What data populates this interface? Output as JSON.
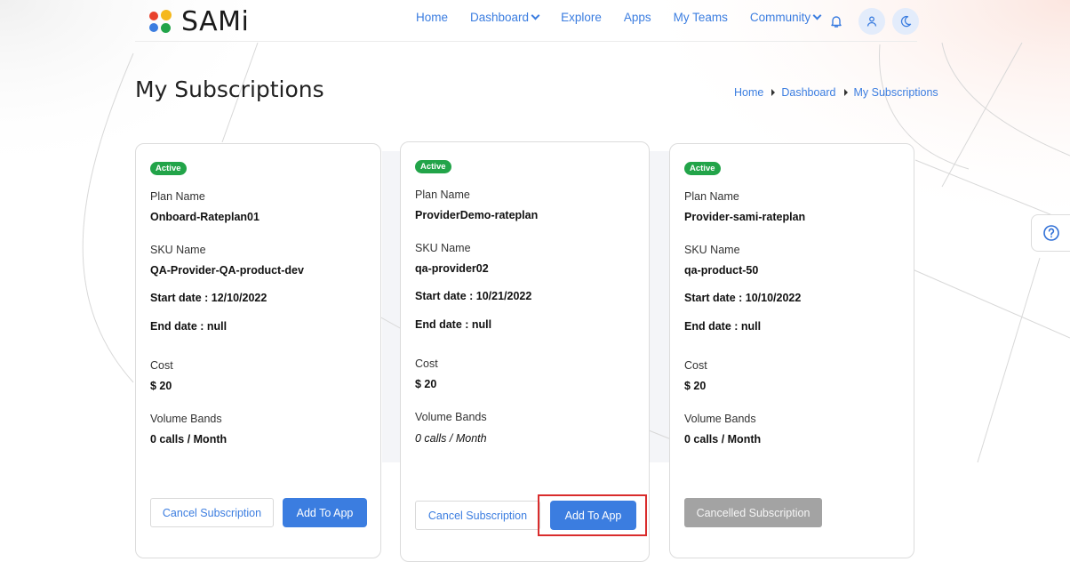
{
  "app": {
    "name": "SAMi"
  },
  "nav": {
    "items": [
      {
        "label": "Home",
        "has_dropdown": false
      },
      {
        "label": "Dashboard",
        "has_dropdown": true
      },
      {
        "label": "Explore",
        "has_dropdown": false
      },
      {
        "label": "Apps",
        "has_dropdown": false
      },
      {
        "label": "My Teams",
        "has_dropdown": false
      },
      {
        "label": "Community",
        "has_dropdown": true
      }
    ],
    "icons": [
      "bell-icon",
      "user-icon",
      "moon-icon"
    ]
  },
  "page": {
    "title": "My Subscriptions"
  },
  "breadcrumb": [
    "Home",
    "Dashboard",
    "My Subscriptions"
  ],
  "labels": {
    "plan_name": "Plan Name",
    "sku_name": "SKU Name",
    "cost": "Cost",
    "volume_bands": "Volume Bands"
  },
  "cards": [
    {
      "status": "Active",
      "plan_name": "Onboard-Rateplan01",
      "sku_name": "QA-Provider-QA-product-dev",
      "start_date": "Start date : 12/10/2022",
      "end_date": "End date : null",
      "cost": "$ 20",
      "volume": "0 calls / Month",
      "cancel_label": "Cancel Subscription",
      "add_label": "Add To App"
    },
    {
      "status": "Active",
      "plan_name": "ProviderDemo-rateplan",
      "sku_name": "qa-provider02",
      "start_date": "Start date : 10/21/2022",
      "end_date": "End date : null",
      "cost": "$ 20",
      "volume": "0 calls / Month",
      "cancel_label": "Cancel Subscription",
      "add_label": "Add To App"
    },
    {
      "status": "Active",
      "plan_name": "Provider-sami-rateplan",
      "sku_name": "qa-product-50",
      "start_date": "Start date : 10/10/2022",
      "end_date": "End date : null",
      "cost": "$ 20",
      "volume": "0 calls / Month",
      "cancelled_label": "Cancelled Subscription"
    }
  ],
  "colors": {
    "accent": "#3b7de0",
    "active_badge": "#22a449",
    "disabled_button": "#a3a3a3",
    "highlight": "#d92c2c"
  },
  "help": {
    "icon": "question-circle-icon"
  }
}
